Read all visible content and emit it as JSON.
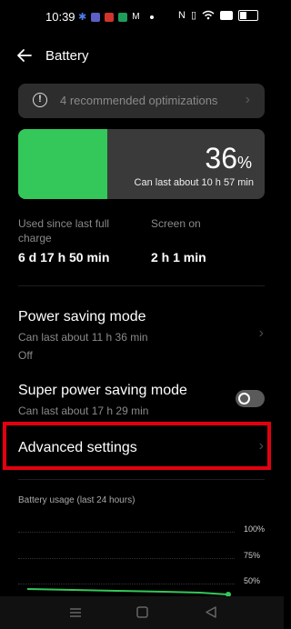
{
  "status_bar": {
    "time": "10:39",
    "icons_left": [
      "settings-icon",
      "teams-icon",
      "m-app-icon",
      "shield-app-icon",
      "gmail-icon",
      "dot-icon"
    ],
    "icons_right": [
      "nfc-icon",
      "vibrate-icon",
      "wifi-icon",
      "battery-saver-icon",
      "battery-icon"
    ]
  },
  "header": {
    "title": "Battery"
  },
  "recommendations": {
    "text": "4 recommended optimizations"
  },
  "battery": {
    "percent": "36",
    "percent_sign": "%",
    "level": 0.36,
    "estimate": "Can last about 10 h 57 min",
    "fill_color": "#34c759"
  },
  "usage": {
    "since_charge_label": "Used since last full charge",
    "since_charge_value": "6 d 17 h 50 min",
    "screen_on_label": "Screen on",
    "screen_on_value": "2 h 1 min"
  },
  "power_saving": {
    "title": "Power saving mode",
    "subtitle": "Can last about 11 h 36 min",
    "state": "Off"
  },
  "super_power_saving": {
    "title": "Super power saving mode",
    "subtitle": "Can last about 17 h 29 min",
    "enabled": false
  },
  "advanced": {
    "title": "Advanced settings",
    "highlight_color": "#e3000f"
  },
  "chart_data": {
    "type": "line",
    "title": "Battery usage (last 24 hours)",
    "y_ticks": [
      "100%",
      "75%",
      "50%"
    ],
    "line_color": "#34c759"
  }
}
